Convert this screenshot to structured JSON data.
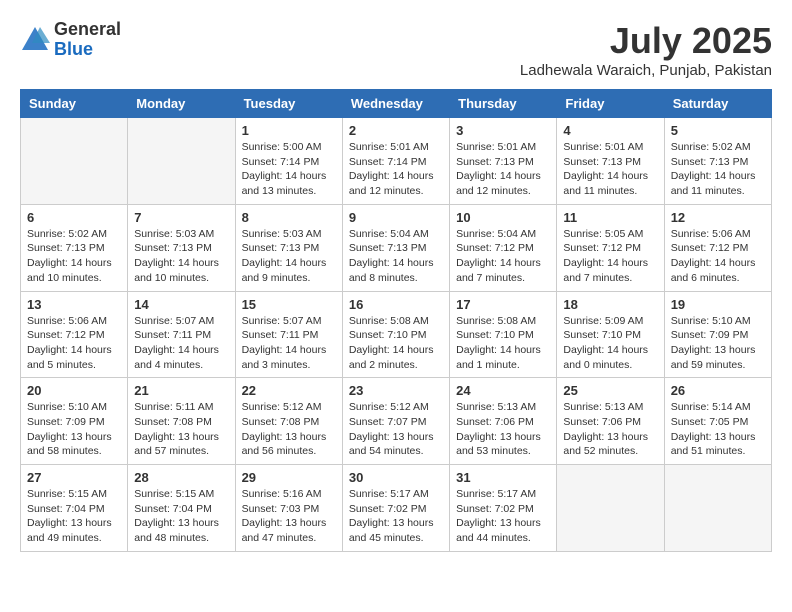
{
  "header": {
    "logo_general": "General",
    "logo_blue": "Blue",
    "month_title": "July 2025",
    "location": "Ladhewala Waraich, Punjab, Pakistan"
  },
  "weekdays": [
    "Sunday",
    "Monday",
    "Tuesday",
    "Wednesday",
    "Thursday",
    "Friday",
    "Saturday"
  ],
  "weeks": [
    [
      {
        "day": "",
        "info": ""
      },
      {
        "day": "",
        "info": ""
      },
      {
        "day": "1",
        "info": "Sunrise: 5:00 AM\nSunset: 7:14 PM\nDaylight: 14 hours\nand 13 minutes."
      },
      {
        "day": "2",
        "info": "Sunrise: 5:01 AM\nSunset: 7:14 PM\nDaylight: 14 hours\nand 12 minutes."
      },
      {
        "day": "3",
        "info": "Sunrise: 5:01 AM\nSunset: 7:13 PM\nDaylight: 14 hours\nand 12 minutes."
      },
      {
        "day": "4",
        "info": "Sunrise: 5:01 AM\nSunset: 7:13 PM\nDaylight: 14 hours\nand 11 minutes."
      },
      {
        "day": "5",
        "info": "Sunrise: 5:02 AM\nSunset: 7:13 PM\nDaylight: 14 hours\nand 11 minutes."
      }
    ],
    [
      {
        "day": "6",
        "info": "Sunrise: 5:02 AM\nSunset: 7:13 PM\nDaylight: 14 hours\nand 10 minutes."
      },
      {
        "day": "7",
        "info": "Sunrise: 5:03 AM\nSunset: 7:13 PM\nDaylight: 14 hours\nand 10 minutes."
      },
      {
        "day": "8",
        "info": "Sunrise: 5:03 AM\nSunset: 7:13 PM\nDaylight: 14 hours\nand 9 minutes."
      },
      {
        "day": "9",
        "info": "Sunrise: 5:04 AM\nSunset: 7:13 PM\nDaylight: 14 hours\nand 8 minutes."
      },
      {
        "day": "10",
        "info": "Sunrise: 5:04 AM\nSunset: 7:12 PM\nDaylight: 14 hours\nand 7 minutes."
      },
      {
        "day": "11",
        "info": "Sunrise: 5:05 AM\nSunset: 7:12 PM\nDaylight: 14 hours\nand 7 minutes."
      },
      {
        "day": "12",
        "info": "Sunrise: 5:06 AM\nSunset: 7:12 PM\nDaylight: 14 hours\nand 6 minutes."
      }
    ],
    [
      {
        "day": "13",
        "info": "Sunrise: 5:06 AM\nSunset: 7:12 PM\nDaylight: 14 hours\nand 5 minutes."
      },
      {
        "day": "14",
        "info": "Sunrise: 5:07 AM\nSunset: 7:11 PM\nDaylight: 14 hours\nand 4 minutes."
      },
      {
        "day": "15",
        "info": "Sunrise: 5:07 AM\nSunset: 7:11 PM\nDaylight: 14 hours\nand 3 minutes."
      },
      {
        "day": "16",
        "info": "Sunrise: 5:08 AM\nSunset: 7:10 PM\nDaylight: 14 hours\nand 2 minutes."
      },
      {
        "day": "17",
        "info": "Sunrise: 5:08 AM\nSunset: 7:10 PM\nDaylight: 14 hours\nand 1 minute."
      },
      {
        "day": "18",
        "info": "Sunrise: 5:09 AM\nSunset: 7:10 PM\nDaylight: 14 hours\nand 0 minutes."
      },
      {
        "day": "19",
        "info": "Sunrise: 5:10 AM\nSunset: 7:09 PM\nDaylight: 13 hours\nand 59 minutes."
      }
    ],
    [
      {
        "day": "20",
        "info": "Sunrise: 5:10 AM\nSunset: 7:09 PM\nDaylight: 13 hours\nand 58 minutes."
      },
      {
        "day": "21",
        "info": "Sunrise: 5:11 AM\nSunset: 7:08 PM\nDaylight: 13 hours\nand 57 minutes."
      },
      {
        "day": "22",
        "info": "Sunrise: 5:12 AM\nSunset: 7:08 PM\nDaylight: 13 hours\nand 56 minutes."
      },
      {
        "day": "23",
        "info": "Sunrise: 5:12 AM\nSunset: 7:07 PM\nDaylight: 13 hours\nand 54 minutes."
      },
      {
        "day": "24",
        "info": "Sunrise: 5:13 AM\nSunset: 7:06 PM\nDaylight: 13 hours\nand 53 minutes."
      },
      {
        "day": "25",
        "info": "Sunrise: 5:13 AM\nSunset: 7:06 PM\nDaylight: 13 hours\nand 52 minutes."
      },
      {
        "day": "26",
        "info": "Sunrise: 5:14 AM\nSunset: 7:05 PM\nDaylight: 13 hours\nand 51 minutes."
      }
    ],
    [
      {
        "day": "27",
        "info": "Sunrise: 5:15 AM\nSunset: 7:04 PM\nDaylight: 13 hours\nand 49 minutes."
      },
      {
        "day": "28",
        "info": "Sunrise: 5:15 AM\nSunset: 7:04 PM\nDaylight: 13 hours\nand 48 minutes."
      },
      {
        "day": "29",
        "info": "Sunrise: 5:16 AM\nSunset: 7:03 PM\nDaylight: 13 hours\nand 47 minutes."
      },
      {
        "day": "30",
        "info": "Sunrise: 5:17 AM\nSunset: 7:02 PM\nDaylight: 13 hours\nand 45 minutes."
      },
      {
        "day": "31",
        "info": "Sunrise: 5:17 AM\nSunset: 7:02 PM\nDaylight: 13 hours\nand 44 minutes."
      },
      {
        "day": "",
        "info": ""
      },
      {
        "day": "",
        "info": ""
      }
    ]
  ]
}
